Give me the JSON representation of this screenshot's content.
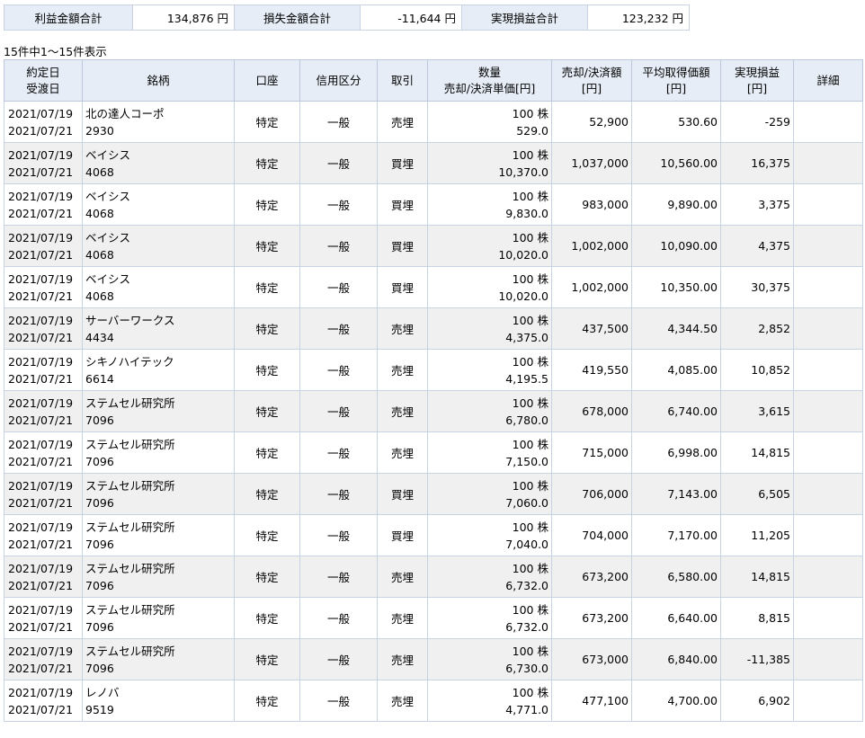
{
  "summary": {
    "profit_label": "利益金額合計",
    "profit_value": "134,876 円",
    "loss_label": "損失金額合計",
    "loss_value": "-11,644 円",
    "realized_label": "実現損益合計",
    "realized_value": "123,232 円"
  },
  "result_count": "15件中1～15件表示",
  "headers": {
    "trade_date": "約定日",
    "settle_date": "受渡日",
    "issue": "銘柄",
    "account": "口座",
    "credit_type": "信用区分",
    "trade_type": "取引",
    "qty": "数量",
    "unit_price": "売却/決済単価[円]",
    "amount_l1": "売却/決済額",
    "amount_l2": "[円]",
    "avg_cost_l1": "平均取得価額",
    "avg_cost_l2": "[円]",
    "pnl_l1": "実現損益",
    "pnl_l2": "[円]",
    "detail": "詳細"
  },
  "rows": [
    {
      "trade_date": "2021/07/19",
      "settle_date": "2021/07/21",
      "name": "北の達人コーポ",
      "code": "2930",
      "account": "特定",
      "credit": "一般",
      "trade": "売埋",
      "qty": "100 株",
      "unit_price": "529.0",
      "amount": "52,900",
      "avg_cost": "530.60",
      "pnl": "-259"
    },
    {
      "trade_date": "2021/07/19",
      "settle_date": "2021/07/21",
      "name": "ベイシス",
      "code": "4068",
      "account": "特定",
      "credit": "一般",
      "trade": "買埋",
      "qty": "100 株",
      "unit_price": "10,370.0",
      "amount": "1,037,000",
      "avg_cost": "10,560.00",
      "pnl": "16,375"
    },
    {
      "trade_date": "2021/07/19",
      "settle_date": "2021/07/21",
      "name": "ベイシス",
      "code": "4068",
      "account": "特定",
      "credit": "一般",
      "trade": "買埋",
      "qty": "100 株",
      "unit_price": "9,830.0",
      "amount": "983,000",
      "avg_cost": "9,890.00",
      "pnl": "3,375"
    },
    {
      "trade_date": "2021/07/19",
      "settle_date": "2021/07/21",
      "name": "ベイシス",
      "code": "4068",
      "account": "特定",
      "credit": "一般",
      "trade": "買埋",
      "qty": "100 株",
      "unit_price": "10,020.0",
      "amount": "1,002,000",
      "avg_cost": "10,090.00",
      "pnl": "4,375"
    },
    {
      "trade_date": "2021/07/19",
      "settle_date": "2021/07/21",
      "name": "ベイシス",
      "code": "4068",
      "account": "特定",
      "credit": "一般",
      "trade": "買埋",
      "qty": "100 株",
      "unit_price": "10,020.0",
      "amount": "1,002,000",
      "avg_cost": "10,350.00",
      "pnl": "30,375"
    },
    {
      "trade_date": "2021/07/19",
      "settle_date": "2021/07/21",
      "name": "サーバーワークス",
      "code": "4434",
      "account": "特定",
      "credit": "一般",
      "trade": "売埋",
      "qty": "100 株",
      "unit_price": "4,375.0",
      "amount": "437,500",
      "avg_cost": "4,344.50",
      "pnl": "2,852"
    },
    {
      "trade_date": "2021/07/19",
      "settle_date": "2021/07/21",
      "name": "シキノハイテック",
      "code": "6614",
      "account": "特定",
      "credit": "一般",
      "trade": "売埋",
      "qty": "100 株",
      "unit_price": "4,195.5",
      "amount": "419,550",
      "avg_cost": "4,085.00",
      "pnl": "10,852"
    },
    {
      "trade_date": "2021/07/19",
      "settle_date": "2021/07/21",
      "name": "ステムセル研究所",
      "code": "7096",
      "account": "特定",
      "credit": "一般",
      "trade": "売埋",
      "qty": "100 株",
      "unit_price": "6,780.0",
      "amount": "678,000",
      "avg_cost": "6,740.00",
      "pnl": "3,615"
    },
    {
      "trade_date": "2021/07/19",
      "settle_date": "2021/07/21",
      "name": "ステムセル研究所",
      "code": "7096",
      "account": "特定",
      "credit": "一般",
      "trade": "売埋",
      "qty": "100 株",
      "unit_price": "7,150.0",
      "amount": "715,000",
      "avg_cost": "6,998.00",
      "pnl": "14,815"
    },
    {
      "trade_date": "2021/07/19",
      "settle_date": "2021/07/21",
      "name": "ステムセル研究所",
      "code": "7096",
      "account": "特定",
      "credit": "一般",
      "trade": "買埋",
      "qty": "100 株",
      "unit_price": "7,060.0",
      "amount": "706,000",
      "avg_cost": "7,143.00",
      "pnl": "6,505"
    },
    {
      "trade_date": "2021/07/19",
      "settle_date": "2021/07/21",
      "name": "ステムセル研究所",
      "code": "7096",
      "account": "特定",
      "credit": "一般",
      "trade": "買埋",
      "qty": "100 株",
      "unit_price": "7,040.0",
      "amount": "704,000",
      "avg_cost": "7,170.00",
      "pnl": "11,205"
    },
    {
      "trade_date": "2021/07/19",
      "settle_date": "2021/07/21",
      "name": "ステムセル研究所",
      "code": "7096",
      "account": "特定",
      "credit": "一般",
      "trade": "売埋",
      "qty": "100 株",
      "unit_price": "6,732.0",
      "amount": "673,200",
      "avg_cost": "6,580.00",
      "pnl": "14,815"
    },
    {
      "trade_date": "2021/07/19",
      "settle_date": "2021/07/21",
      "name": "ステムセル研究所",
      "code": "7096",
      "account": "特定",
      "credit": "一般",
      "trade": "売埋",
      "qty": "100 株",
      "unit_price": "6,732.0",
      "amount": "673,200",
      "avg_cost": "6,640.00",
      "pnl": "8,815"
    },
    {
      "trade_date": "2021/07/19",
      "settle_date": "2021/07/21",
      "name": "ステムセル研究所",
      "code": "7096",
      "account": "特定",
      "credit": "一般",
      "trade": "売埋",
      "qty": "100 株",
      "unit_price": "6,730.0",
      "amount": "673,000",
      "avg_cost": "6,840.00",
      "pnl": "-11,385"
    },
    {
      "trade_date": "2021/07/19",
      "settle_date": "2021/07/21",
      "name": "レノバ",
      "code": "9519",
      "account": "特定",
      "credit": "一般",
      "trade": "売埋",
      "qty": "100 株",
      "unit_price": "4,771.0",
      "amount": "477,100",
      "avg_cost": "4,700.00",
      "pnl": "6,902"
    }
  ]
}
